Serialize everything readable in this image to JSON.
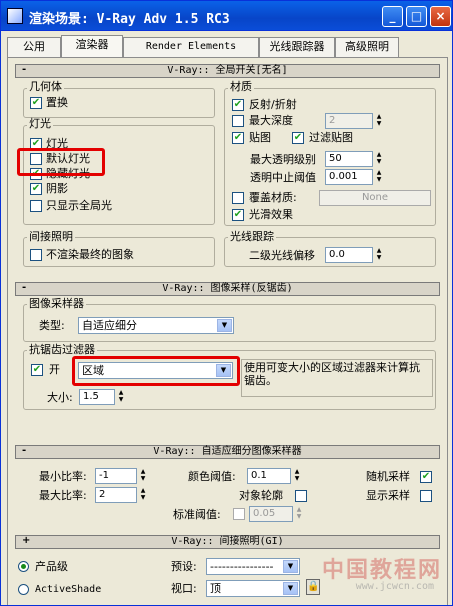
{
  "window": {
    "title": "渲染场景: V-Ray Adv 1.5 RC3",
    "min": "_",
    "max": "□",
    "close": "×"
  },
  "tabs": [
    "公用",
    "渲染器",
    "Render Elements",
    "光线跟踪器",
    "高级照明"
  ],
  "global_switches": {
    "rollout_title": "V-Ray:: 全局开关[无名]",
    "geometry": {
      "label": "几何体",
      "displacement": "置换"
    },
    "lighting": {
      "label": "灯光",
      "lights": "灯光",
      "default_lights": "默认灯光",
      "hidden_lights": "隐藏灯光",
      "shadows": "阴影",
      "show_gi_only": "只显示全局光"
    },
    "indirect": {
      "label": "间接照明",
      "dont_render_final": "不渲染最终的图象"
    },
    "materials": {
      "label": "材质",
      "reflection_refraction": "反射/折射",
      "max_depth": "最大深度",
      "max_depth_value": "2",
      "maps": "贴图",
      "filter_maps": "过滤贴图",
      "max_transp_levels": "最大透明级别",
      "max_transp_value": "50",
      "transp_cutoff": "透明中止阈值",
      "transp_cutoff_value": "0.001",
      "override_mtl": "覆盖材质:",
      "override_btn": "None",
      "glossy": "光滑效果"
    },
    "raytracing": {
      "label": "光线跟踪",
      "secondary_bias": "二级光线偏移",
      "secondary_bias_value": "0.0"
    }
  },
  "image_sampler": {
    "rollout_title": "V-Ray:: 图像采样(反锯齿)",
    "sampler_label": "图像采样器",
    "type_label": "类型:",
    "type_value": "自适应细分",
    "aa_label": "抗锯齿过滤器",
    "on_label": "开",
    "filter_value": "区域",
    "size_label": "大小:",
    "size_value": "1.5",
    "description": "使用可变大小的区域过滤器来计算抗锯齿。"
  },
  "adaptive": {
    "rollout_title": "V-Ray:: 自适应细分图像采样器",
    "min_rate": "最小比率:",
    "min_rate_value": "-1",
    "max_rate": "最大比率:",
    "max_rate_value": "2",
    "clr_thresh": "颜色阈值:",
    "clr_thresh_value": "0.1",
    "object_outline": "对象轮廓",
    "normal_thresh": "标准阈值:",
    "normal_thresh_value": "0.05",
    "randomize": "随机采样",
    "show_samples": "显示采样"
  },
  "gi_rollout_title": "V-Ray:: 间接照明(GI)",
  "bottom": {
    "production": "产品级",
    "activeshade": "ActiveShade",
    "preset_label": "预设:",
    "preset_value": "----------------",
    "viewport_label": "视口:",
    "viewport_value": "顶"
  },
  "watermark": "中国教程网",
  "watermark_url": "www.jcwcn.com"
}
